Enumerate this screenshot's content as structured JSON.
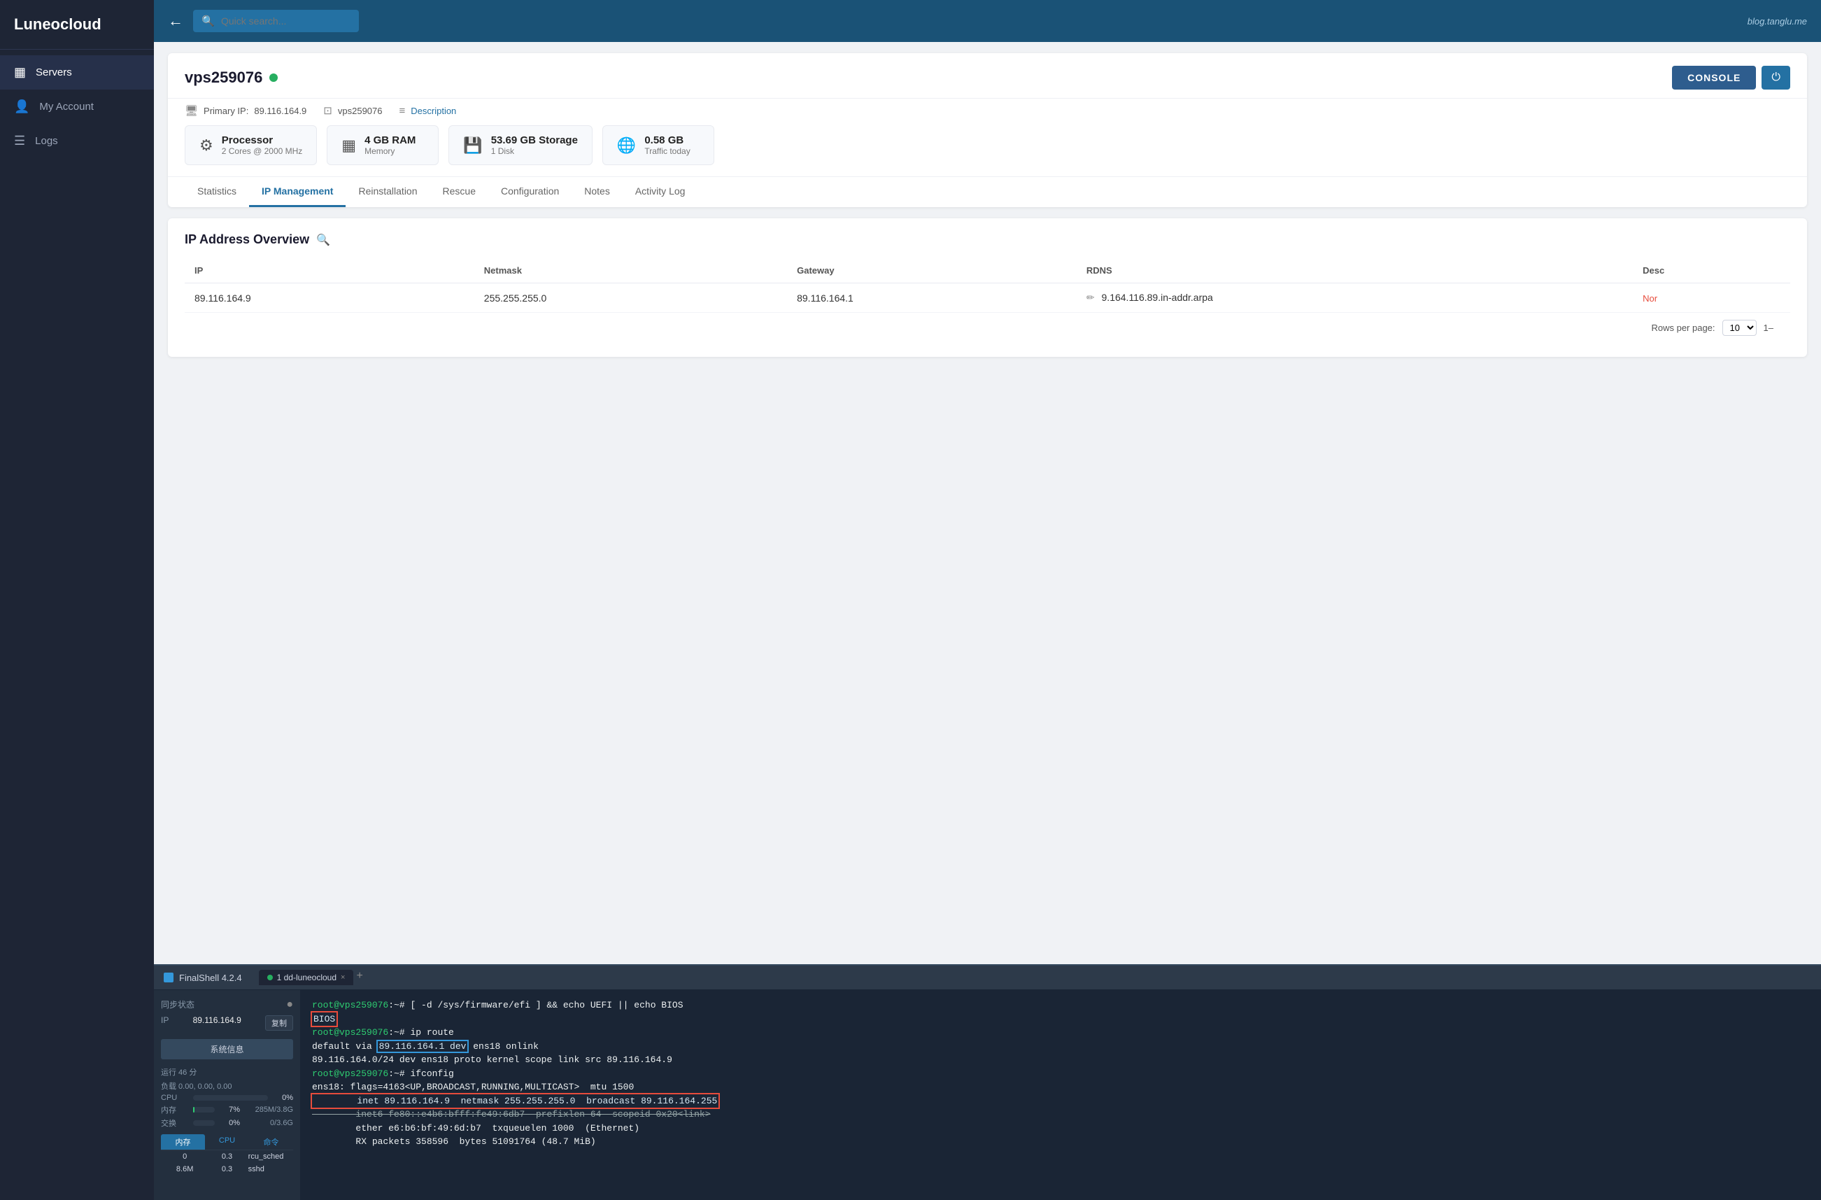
{
  "sidebar": {
    "logo": "Luneocloud",
    "items": [
      {
        "id": "servers",
        "label": "Servers",
        "icon": "▦",
        "active": true
      },
      {
        "id": "my-account",
        "label": "My Account",
        "icon": "👤",
        "active": false
      },
      {
        "id": "logs",
        "label": "Logs",
        "icon": "☰",
        "active": false
      }
    ]
  },
  "topbar": {
    "search_placeholder": "Quick search...",
    "watermark": "blog.tanglu.me"
  },
  "server": {
    "name": "vps259076",
    "status": "online",
    "primary_ip_label": "Primary IP:",
    "primary_ip": "89.116.164.9",
    "hostname": "vps259076",
    "description_label": "Description",
    "processor_title": "Processor",
    "processor_detail": "2 Cores @ 2000 MHz",
    "ram_title": "4 GB RAM",
    "ram_sub": "Memory",
    "storage_title": "53.69 GB Storage",
    "storage_sub": "1 Disk",
    "traffic_title": "0.58 GB",
    "traffic_sub": "Traffic today",
    "console_btn": "CONSOLE",
    "tabs": [
      {
        "id": "statistics",
        "label": "Statistics"
      },
      {
        "id": "ip-management",
        "label": "IP Management",
        "active": true
      },
      {
        "id": "reinstallation",
        "label": "Reinstallation"
      },
      {
        "id": "rescue",
        "label": "Rescue"
      },
      {
        "id": "configuration",
        "label": "Configuration"
      },
      {
        "id": "notes",
        "label": "Notes"
      },
      {
        "id": "activity-log",
        "label": "Activity Log"
      }
    ]
  },
  "ip_overview": {
    "title": "IP Address Overview",
    "columns": [
      "IP",
      "Netmask",
      "Gateway",
      "RDNS",
      "Desc"
    ],
    "rows": [
      {
        "ip": "89.116.164.9",
        "netmask": "255.255.255.0",
        "gateway": "89.116.164.1",
        "rdns": "9.164.116.89.in-addr.arpa",
        "rdns_edit": "✏",
        "desc_link": "Nor"
      }
    ],
    "rows_per_page_label": "Rows per page:",
    "rows_per_page_value": "10",
    "page_info": "1–"
  },
  "terminal": {
    "app_name": "FinalShell 4.2.4",
    "sync_status_label": "同步状态",
    "ip_label": "IP",
    "ip_value": "89.116.164.9",
    "copy_btn": "复制",
    "sysinfo_btn": "系统信息",
    "uptime_label": "运行 46 分",
    "load_label": "负载 0.00, 0.00, 0.00",
    "cpu_label": "CPU",
    "cpu_pct": "0%",
    "ram_label": "内存",
    "ram_pct": "7%",
    "ram_detail": "285M/3.8G",
    "swap_label": "交换",
    "swap_pct": "0%",
    "swap_detail": "0/3.6G",
    "tab_label": "1  dd-luneocloud",
    "tab_close": "×",
    "tab_plus": "+",
    "table_headers": [
      "内存",
      "CPU",
      "命令"
    ],
    "table_rows": [
      {
        "mem": "0",
        "cpu": "0.3",
        "cmd": "rcu_sched"
      },
      {
        "mem": "8.6M",
        "cpu": "0.3",
        "cmd": "sshd"
      }
    ],
    "terminal_lines": [
      {
        "type": "prompt",
        "text": "root@vps259076:~# [ -d /sys/firmware/efi ] && echo UEFI || echo BIOS"
      },
      {
        "type": "highlight-red",
        "text": "BIOS"
      },
      {
        "type": "prompt",
        "text": "root@vps259076:~# ip route"
      },
      {
        "type": "normal",
        "text": "default via ",
        "span_highlight": true,
        "span_text": "89.116.164.1 dev",
        "after": " ens18 onlink"
      },
      {
        "type": "normal",
        "text": "89.116.164.0/24 dev ens18 proto kernel scope link src 89.116.164.9"
      },
      {
        "type": "prompt",
        "text": "root@vps259076:~# ifconfig"
      },
      {
        "type": "normal",
        "text": "ens18: flags=4163<UP,BROADCAST,RUNNING,MULTICAST>  mtu 1500"
      },
      {
        "type": "highlight-box",
        "text": "        inet 89.116.164.9  netmask 255.255.255.0  broadcast 89.116.164.255"
      },
      {
        "type": "strikethrough",
        "text": "        inet6 fe80::e4b6:bfff:fe49:6db7  prefixlen 64  scopeid 0x20<link>"
      },
      {
        "type": "normal",
        "text": "        ether e6:b6:bf:49:6d:b7  txqueuelen 1000  (Ethernet)"
      },
      {
        "type": "normal",
        "text": "        RX packets 358596  bytes 51091764 (48.7 MiB)"
      }
    ]
  }
}
